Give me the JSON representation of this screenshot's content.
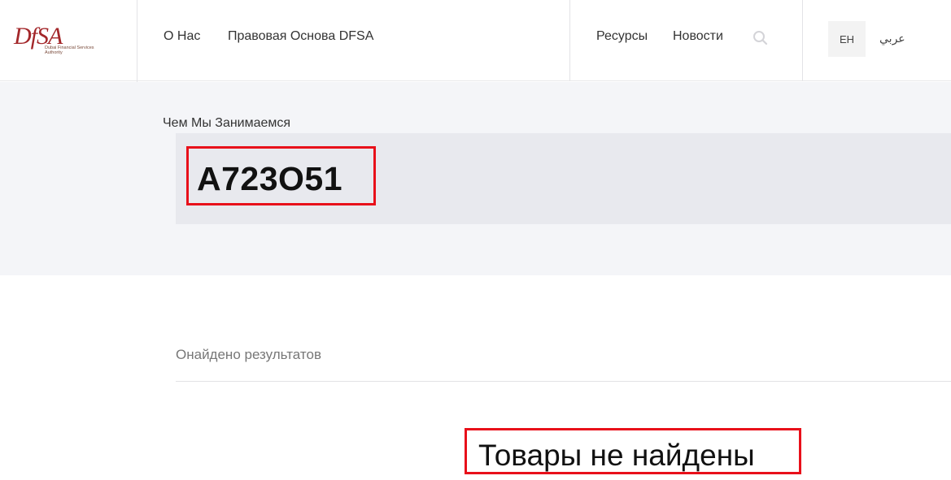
{
  "header": {
    "logo": {
      "mark": "DfSA",
      "subtitle": "Dubai Financial Services Authority"
    },
    "nav_left": [
      {
        "label": "О Нас"
      },
      {
        "label": "Правовая Основа DFSA"
      }
    ],
    "nav_right": [
      {
        "label": "Ресурсы"
      },
      {
        "label": "Новости"
      }
    ],
    "search_icon": "search-icon",
    "languages": {
      "en": "EH",
      "ar": "عربي"
    }
  },
  "hero": {
    "breadcrumb": "Чем Мы Занимаемся",
    "search_query": "A723O51"
  },
  "results": {
    "label": "Онайдено результатов",
    "empty_message": "Товары не найдены"
  },
  "colors": {
    "brand": "#a3272a",
    "highlight": "#e8101a",
    "hero_bg": "#f4f5f8",
    "search_bg": "#e8e9ee"
  }
}
